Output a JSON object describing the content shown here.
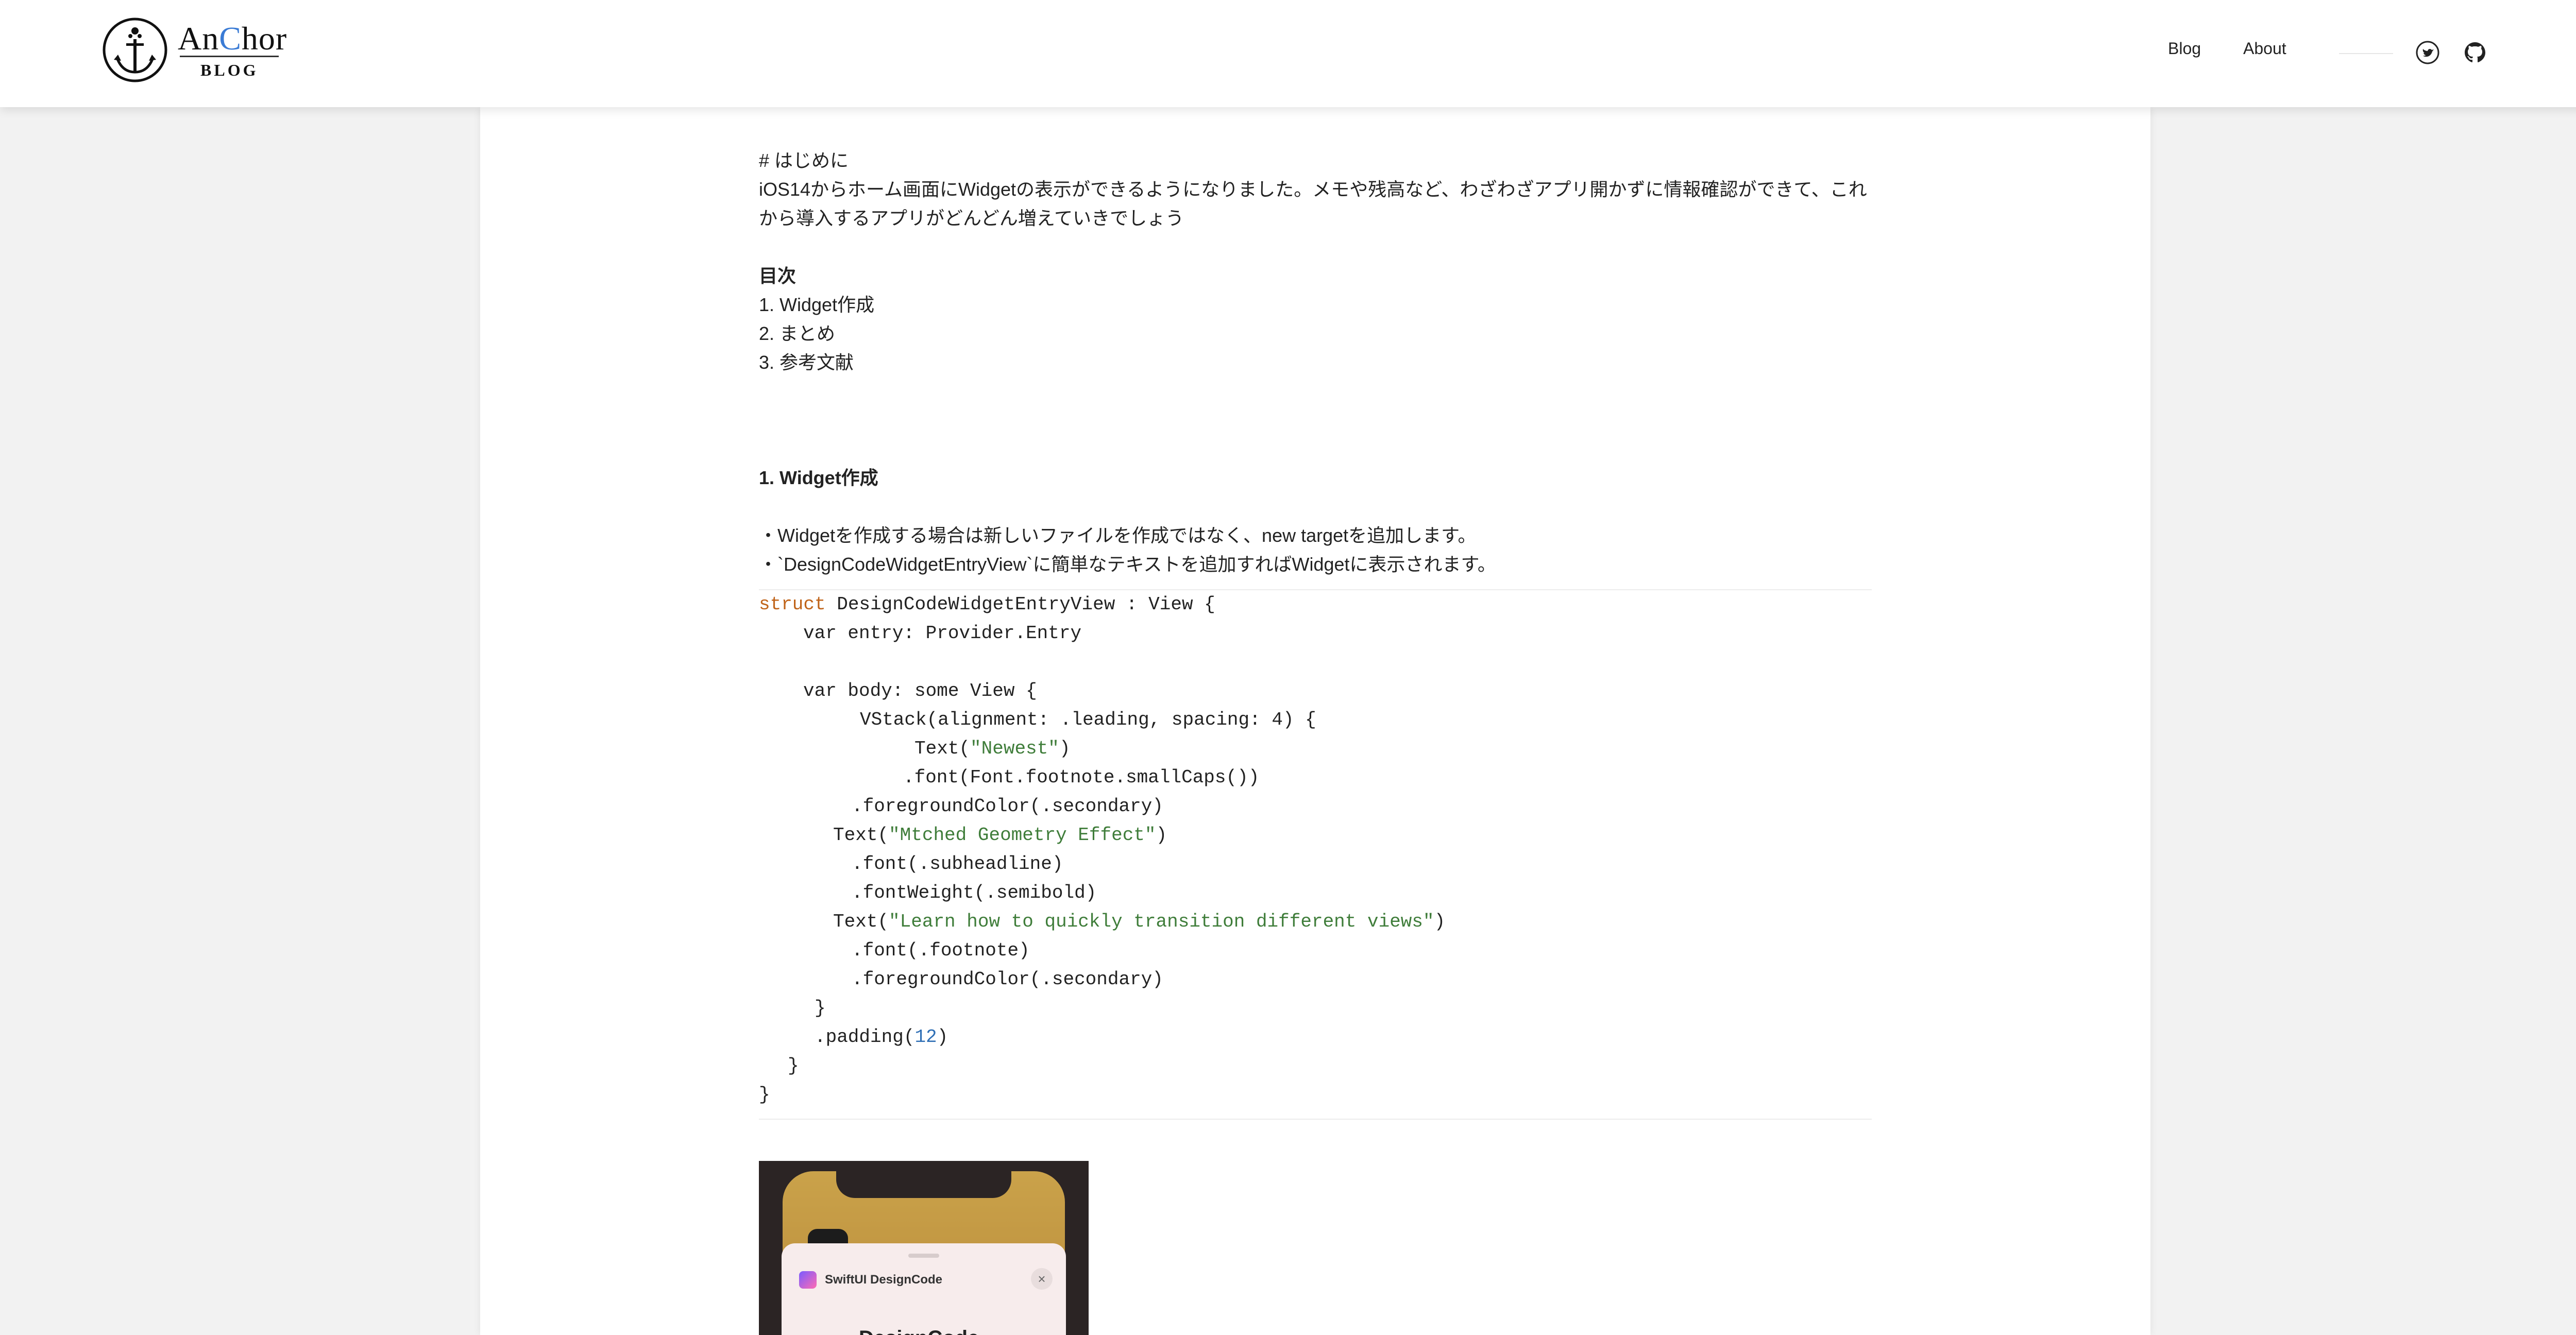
{
  "header": {
    "logo": {
      "name": "AnChor",
      "name_before": "An",
      "name_accent": "C",
      "name_after": "hor",
      "subtitle": "BLOG"
    },
    "nav": {
      "blog": "Blog",
      "about": "About"
    },
    "social": {
      "twitter": "twitter-icon",
      "github": "github-icon"
    }
  },
  "article": {
    "intro_heading": "# はじめに",
    "intro_line1": "iOS14からホーム画面にWidgetの表示ができるようになりました。メモや残高など、わざわざアプリ開かずに情報確認ができて、これ",
    "intro_line2": "から導入するアプリがどんどん増えていきでしょう",
    "toc_title": "目次",
    "toc": [
      "1. Widget作成",
      "2. まとめ",
      "3. 参考文献"
    ],
    "section1_title": "1. Widget作成",
    "bullet1": "・Widgetを作成する場合は新しいファイルを作成ではなく、new targetを追加します。",
    "bullet2": "・`DesignCodeWidgetEntryView`に簡単なテキストを追加すればWidgetに表示されます。"
  },
  "code": {
    "l1_kw": "struct",
    "l1_rest": " DesignCodeWidgetEntryView : View {",
    "l2": "var entry: Provider.Entry",
    "l4": "var body: some View {",
    "l5": "VStack(alignment: .leading, spacing: 4) {",
    "l6_a": "Text(",
    "l6_s": "\"Newest\"",
    "l6_b": ")",
    "l7": ".font(Font.footnote.smallCaps())",
    "l8": ".foregroundColor(.secondary)",
    "l9_a": "Text(",
    "l9_s": "\"Mtched Geometry Effect\"",
    "l9_b": ")",
    "l10": ".font(.subheadline)",
    "l11": ".fontWeight(.semibold)",
    "l12_a": "Text(",
    "l12_s": "\"Learn how to quickly transition different views\"",
    "l12_b": ")",
    "l13": ".font(.footnote)",
    "l14": ".foregroundColor(.secondary)",
    "l15": "}",
    "l16_a": ".padding(",
    "l16_n": "12",
    "l16_b": ")",
    "l17": "}",
    "l18": "}"
  },
  "phone": {
    "sheet_title": "SwiftUI DesignCode",
    "close_glyph": "×",
    "heading": "DesignCode"
  },
  "colors": {
    "accent": "#3a7bd5",
    "keyword": "#c0641a",
    "string": "#3f7d3a",
    "number": "#2f6fb5"
  }
}
